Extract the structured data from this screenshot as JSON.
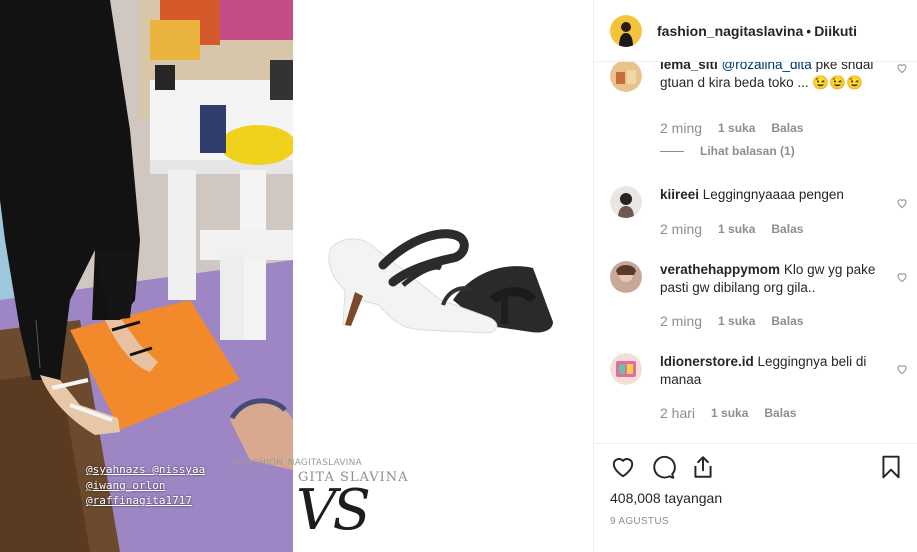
{
  "post": {
    "tags": [
      "@syahnazs @nissyaa",
      "@iwang_orlon",
      "@raffinagita1717"
    ],
    "watermark": "@FASHION_NAGITASLAVINA",
    "watermark2": "GITA SLAVINA",
    "vs_text": "VS"
  },
  "header": {
    "username": "fashion_nagitaslavina",
    "separator": "•",
    "follow_status": "Diikuti"
  },
  "comments": [
    {
      "username": "lema_siti",
      "mention": "@rozalina_dita",
      "text": "pke sndal gtuan d kira beda toko ... 😉😉😉",
      "time": "2 ming",
      "likes": "1 suka",
      "reply": "Balas",
      "view_replies": "Lihat balasan (1)"
    },
    {
      "username": "kiireei",
      "text": "Leggingnyaaaa pengen",
      "time": "2 ming",
      "likes": "1 suka",
      "reply": "Balas"
    },
    {
      "username": "verathehappymom",
      "text": "Klo gw yg pake pasti gw dibilang org gila..",
      "time": "2 ming",
      "likes": "1 suka",
      "reply": "Balas"
    },
    {
      "username": "ldionerstore.id",
      "text": "Leggingnya beli di manaa",
      "time": "2 hari",
      "likes": "1 suka",
      "reply": "Balas"
    }
  ],
  "footer": {
    "views_count": "408,008",
    "views_label": "tayangan",
    "date": "9 AGUSTUS"
  },
  "icons": {
    "like": "heart-icon",
    "comment": "comment-icon",
    "share": "share-icon",
    "save": "bookmark-icon"
  },
  "colors": {
    "text": "#262626",
    "muted": "#8e8e8e",
    "mention": "#003569",
    "border": "#efefef"
  }
}
